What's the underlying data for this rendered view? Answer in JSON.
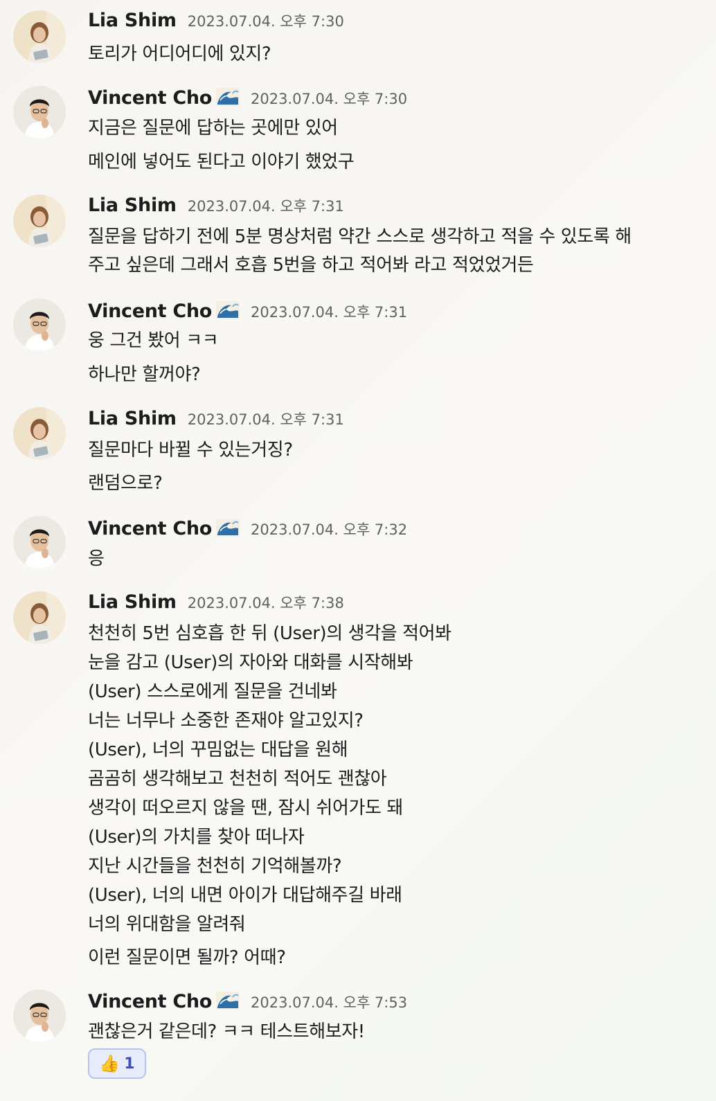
{
  "users": {
    "lia": {
      "name": "Lia Shim"
    },
    "vincent": {
      "name": "Vincent Cho",
      "status_emoji": "wave-emoji"
    }
  },
  "messages": [
    {
      "author": "Lia Shim",
      "timestamp": "2023.07.04. 오후 7:30",
      "lines": [
        "토리가 어디어디에 있지?"
      ]
    },
    {
      "author": "Vincent Cho",
      "timestamp": "2023.07.04. 오후 7:30",
      "lines": [
        "지금은 질문에 답하는 곳에만 있어",
        "메인에 넣어도 된다고 이야기 했었구"
      ]
    },
    {
      "author": "Lia Shim",
      "timestamp": "2023.07.04. 오후 7:31",
      "lines": [
        "질문을 답하기 전에 5분 명상처럼 약간 스스로 생각하고 적을 수 있도록 해",
        "주고 싶은데 그래서 호흡 5번을 하고 적어봐 라고 적었었거든"
      ]
    },
    {
      "author": "Vincent Cho",
      "timestamp": "2023.07.04. 오후 7:31",
      "lines": [
        "웅 그건 봤어 ㅋㅋ",
        "하나만 할꺼야?"
      ]
    },
    {
      "author": "Lia Shim",
      "timestamp": "2023.07.04. 오후 7:31",
      "lines": [
        "질문마다 바뀔 수 있는거징?",
        "랜덤으로?"
      ]
    },
    {
      "author": "Vincent Cho",
      "timestamp": "2023.07.04. 오후 7:32",
      "lines": [
        "응"
      ]
    },
    {
      "author": "Lia Shim",
      "timestamp": "2023.07.04. 오후 7:38",
      "lines": [
        "천천히 5번 심호흡 한 뒤 (User)의 생각을 적어봐",
        "눈을 감고 (User)의 자아와 대화를 시작해봐",
        "(User) 스스로에게 질문을 건네봐",
        "너는 너무나 소중한 존재야 알고있지?",
        "(User), 너의 꾸밈없는 대답을 원해",
        "곰곰히 생각해보고 천천히 적어도 괜찮아",
        "생각이 떠오르지 않을 땐, 잠시 쉬어가도 돼",
        "(User)의 가치를 찾아 떠나자",
        "지난 시간들을 천천히 기억해볼까?",
        "(User), 너의 내면 아이가 대답해주길 바래",
        "너의 위대함을 알려줘",
        "이런 질문이면 될까? 어때?"
      ]
    },
    {
      "author": "Vincent Cho",
      "timestamp": "2023.07.04. 오후 7:53",
      "lines": [
        "괜찮은거 같은데? ㅋㅋ 테스트해보자!"
      ],
      "reaction": {
        "emoji": "👍",
        "icon": "thumbs-up-icon",
        "count": "1"
      }
    }
  ],
  "colors": {
    "reaction_border": "#b9c2ee",
    "reaction_bg": "#e9ecfb",
    "reaction_count": "#3d4fb5",
    "timestamp": "#616061"
  }
}
